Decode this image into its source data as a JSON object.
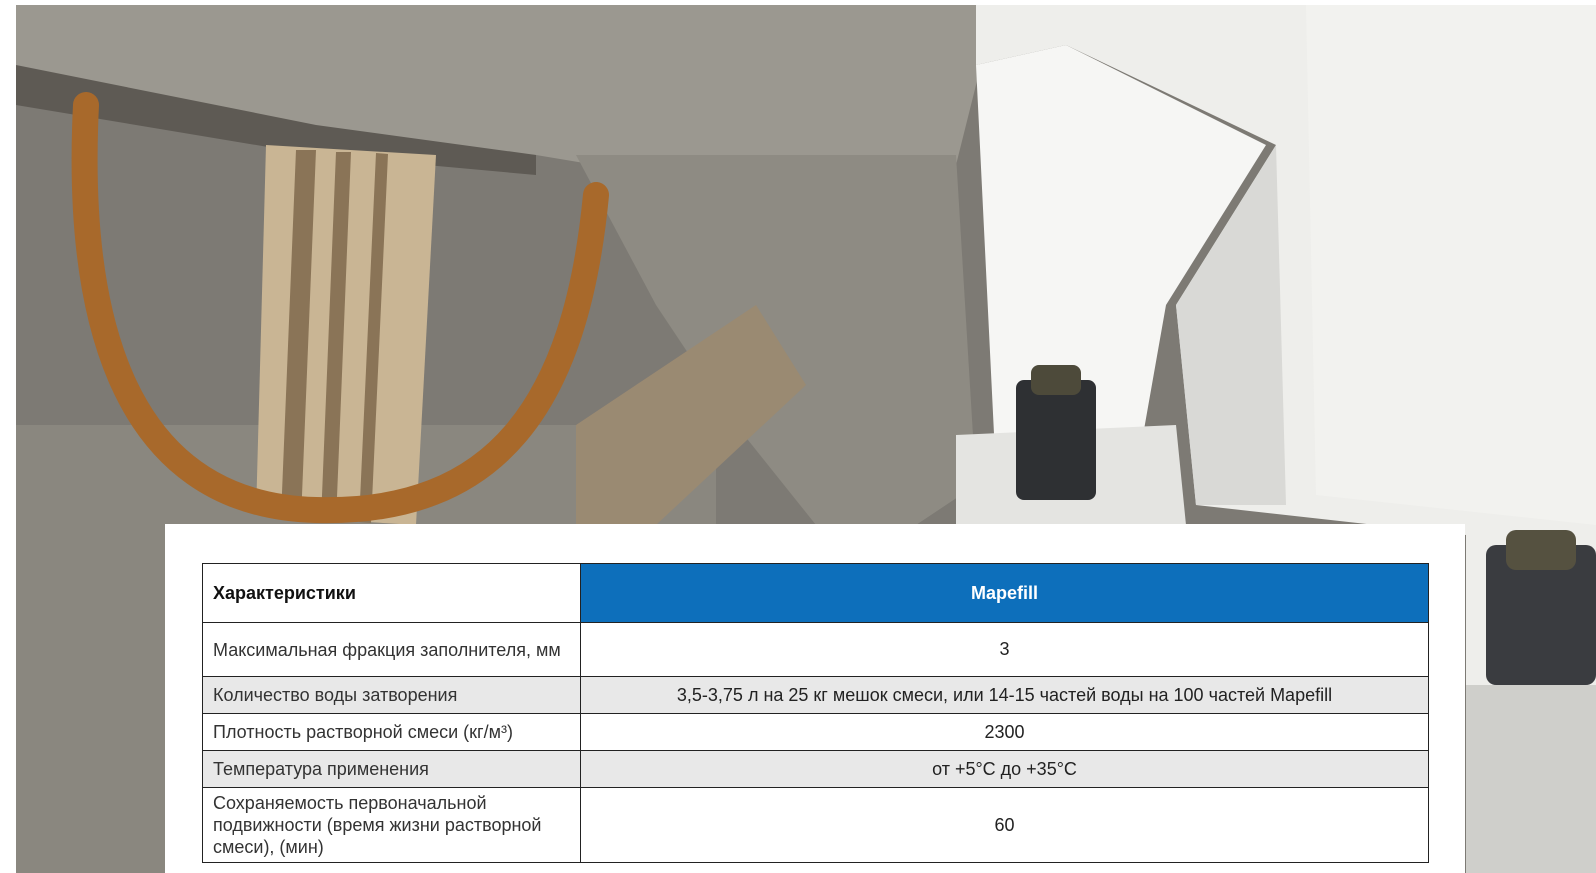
{
  "photo": {
    "subject": "construction photo: steel column base plate with bolts, grout poured under base, gravel and rusty rebar",
    "colors": {
      "grout": "#8f8c85",
      "steel_paint": "#ecebe8",
      "bolt": "#2f3134",
      "rust": "#a86a2a"
    }
  },
  "table": {
    "header": {
      "characteristic": "Характеристики",
      "product": "Mapefill"
    },
    "header_color": "#0d6fbb",
    "rows": [
      {
        "label": "Максимальная фракция заполнителя, мм",
        "value": "3"
      },
      {
        "label": "Количество воды затворения",
        "value": "3,5-3,75 л на 25 кг мешок смеси, или 14-15 частей воды на 100 частей Mapefill"
      },
      {
        "label": "Плотность растворной смеси (кг/м³)",
        "value": "2300"
      },
      {
        "label": "Температура применения",
        "value": "от +5°С до +35°С"
      },
      {
        "label": "Сохраняемость первоначальной подвижности (время жизни растворной смеси), (мин)",
        "value": "60"
      }
    ]
  }
}
